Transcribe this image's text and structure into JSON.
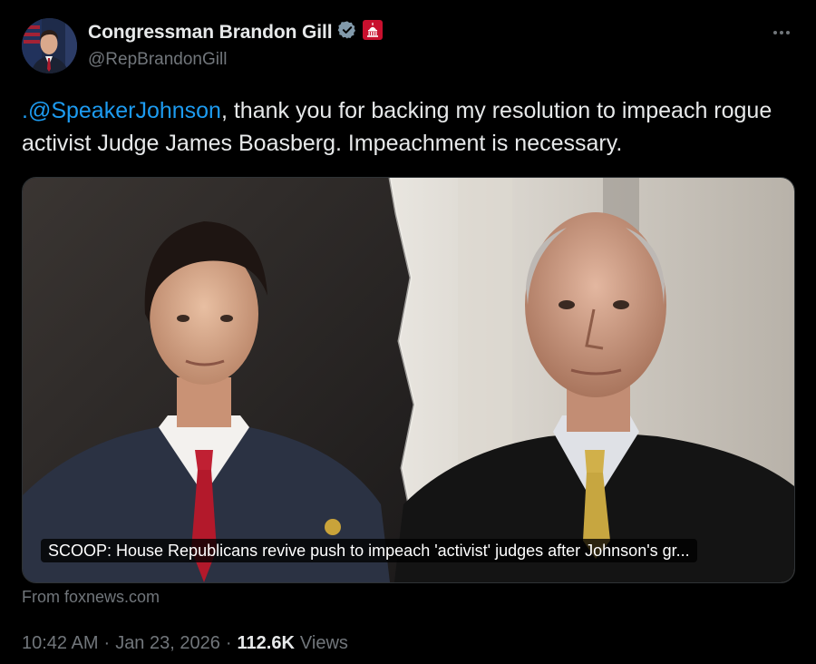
{
  "author": {
    "display_name": "Congressman Brandon Gill",
    "handle": "@RepBrandonGill",
    "verified_icon": "verified-badge-icon",
    "affiliation_icon": "capitol-dome-icon"
  },
  "tweet": {
    "mention": ".@SpeakerJohnson",
    "text": ", thank you for backing my resolution to impeach rogue activist Judge James Boasberg. Impeachment is necessary."
  },
  "card": {
    "caption": "SCOOP: House Republicans revive push to impeach 'activist' judges after Johnson's gr...",
    "source": "From foxnews.com"
  },
  "meta": {
    "time": "10:42 AM",
    "separator": "·",
    "date": "Jan 23, 2026",
    "views_count": "112.6K",
    "views_label": "Views"
  },
  "colors": {
    "background": "#000000",
    "text": "#e7e9ea",
    "secondary": "#71767b",
    "link": "#1d9bf0",
    "verified": "#829aab",
    "affiliation_badge": "#c8102e"
  }
}
